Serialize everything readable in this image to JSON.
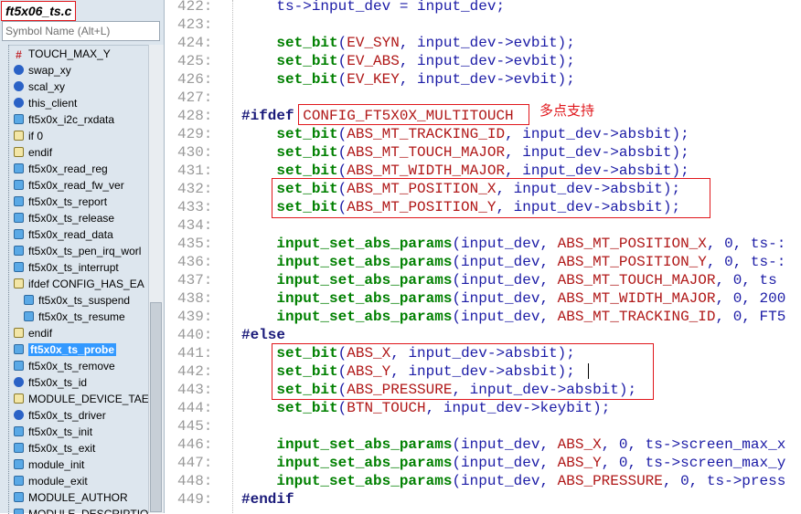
{
  "file_title": "ft5x06_ts.c",
  "search": {
    "placeholder": "Symbol Name (Alt+L)"
  },
  "symbols": [
    {
      "label": "TOUCH_MAX_Y",
      "icon": "macro-icon"
    },
    {
      "label": "swap_xy",
      "icon": "function-icon"
    },
    {
      "label": "scal_xy",
      "icon": "function-icon"
    },
    {
      "label": "this_client",
      "icon": "function-icon"
    },
    {
      "label": "ft5x0x_i2c_rxdata",
      "icon": "variable-icon"
    },
    {
      "label": "if 0",
      "icon": "preprocessor-icon"
    },
    {
      "label": "endif",
      "icon": "preprocessor-icon"
    },
    {
      "label": "ft5x0x_read_reg",
      "icon": "variable-icon"
    },
    {
      "label": "ft5x0x_read_fw_ver",
      "icon": "variable-icon"
    },
    {
      "label": "ft5x0x_ts_report",
      "icon": "variable-icon"
    },
    {
      "label": "ft5x0x_ts_release",
      "icon": "variable-icon"
    },
    {
      "label": "ft5x0x_read_data",
      "icon": "variable-icon"
    },
    {
      "label": "ft5x0x_ts_pen_irq_worl",
      "icon": "variable-icon"
    },
    {
      "label": "ft5x0x_ts_interrupt",
      "icon": "variable-icon"
    },
    {
      "label": "ifdef CONFIG_HAS_EA",
      "icon": "preprocessor-icon"
    },
    {
      "label": "ft5x0x_ts_suspend",
      "icon": "variable-icon"
    },
    {
      "label": "ft5x0x_ts_resume",
      "icon": "variable-icon"
    },
    {
      "label": "endif",
      "icon": "preprocessor-icon"
    },
    {
      "label": "ft5x0x_ts_probe",
      "icon": "variable-icon"
    },
    {
      "label": "ft5x0x_ts_remove",
      "icon": "variable-icon"
    },
    {
      "label": "ft5x0x_ts_id",
      "icon": "function-icon"
    },
    {
      "label": "MODULE_DEVICE_TAE",
      "icon": "preprocessor-icon"
    },
    {
      "label": "ft5x0x_ts_driver",
      "icon": "function-icon"
    },
    {
      "label": "ft5x0x_ts_init",
      "icon": "variable-icon"
    },
    {
      "label": "ft5x0x_ts_exit",
      "icon": "variable-icon"
    },
    {
      "label": "module_init",
      "icon": "variable-icon"
    },
    {
      "label": "module_exit",
      "icon": "variable-icon"
    },
    {
      "label": "MODULE_AUTHOR",
      "icon": "variable-icon"
    },
    {
      "label": "MODULE_DESCRIPTIO",
      "icon": "variable-icon"
    }
  ],
  "annotation": "多点支持",
  "code": [
    {
      "n": "422:",
      "text": "    ts->input_dev = input_dev;"
    },
    {
      "n": "423:",
      "text": ""
    },
    {
      "n": "424:",
      "text": "    set_bit(EV_SYN, input_dev->evbit);"
    },
    {
      "n": "425:",
      "text": "    set_bit(EV_ABS, input_dev->evbit);"
    },
    {
      "n": "426:",
      "text": "    set_bit(EV_KEY, input_dev->evbit);"
    },
    {
      "n": "427:",
      "text": ""
    },
    {
      "n": "428:",
      "text": "#ifdef CONFIG_FT5X0X_MULTITOUCH"
    },
    {
      "n": "429:",
      "text": "    set_bit(ABS_MT_TRACKING_ID, input_dev->absbit);"
    },
    {
      "n": "430:",
      "text": "    set_bit(ABS_MT_TOUCH_MAJOR, input_dev->absbit);"
    },
    {
      "n": "431:",
      "text": "    set_bit(ABS_MT_WIDTH_MAJOR, input_dev->absbit);"
    },
    {
      "n": "432:",
      "text": "    set_bit(ABS_MT_POSITION_X, input_dev->absbit);"
    },
    {
      "n": "433:",
      "text": "    set_bit(ABS_MT_POSITION_Y, input_dev->absbit);"
    },
    {
      "n": "434:",
      "text": ""
    },
    {
      "n": "435:",
      "text": "    input_set_abs_params(input_dev, ABS_MT_POSITION_X, 0, ts-:"
    },
    {
      "n": "436:",
      "text": "    input_set_abs_params(input_dev, ABS_MT_POSITION_Y, 0, ts-:"
    },
    {
      "n": "437:",
      "text": "    input_set_abs_params(input_dev, ABS_MT_TOUCH_MAJOR, 0, ts"
    },
    {
      "n": "438:",
      "text": "    input_set_abs_params(input_dev, ABS_MT_WIDTH_MAJOR, 0, 200"
    },
    {
      "n": "439:",
      "text": "    input_set_abs_params(input_dev, ABS_MT_TRACKING_ID, 0, FT5"
    },
    {
      "n": "440:",
      "text": "#else"
    },
    {
      "n": "441:",
      "text": "    set_bit(ABS_X, input_dev->absbit);"
    },
    {
      "n": "442:",
      "text": "    set_bit(ABS_Y, input_dev->absbit);"
    },
    {
      "n": "443:",
      "text": "    set_bit(ABS_PRESSURE, input_dev->absbit);"
    },
    {
      "n": "444:",
      "text": "    set_bit(BTN_TOUCH, input_dev->keybit);"
    },
    {
      "n": "445:",
      "text": ""
    },
    {
      "n": "446:",
      "text": "    input_set_abs_params(input_dev, ABS_X, 0, ts->screen_max_x"
    },
    {
      "n": "447:",
      "text": "    input_set_abs_params(input_dev, ABS_Y, 0, ts->screen_max_y"
    },
    {
      "n": "448:",
      "text": "    input_set_abs_params(input_dev, ABS_PRESSURE, 0, ts->press"
    },
    {
      "n": "449:",
      "text": "#endif"
    }
  ]
}
